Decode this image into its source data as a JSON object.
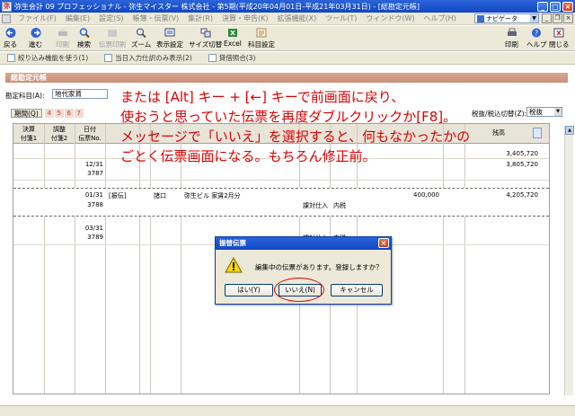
{
  "window": {
    "title": "弥生会計 09 プロフェッショナル - 弥生マイスター 株式会社 - 第5期(平成20年04月01日-平成21年03月31日) - [総勘定元帳]"
  },
  "menu": {
    "items": [
      "ファイル(F)",
      "編集(E)",
      "設定(S)",
      "帳簿・伝票(V)",
      "集計(R)",
      "決算・申告(K)",
      "拡張機能(X)",
      "ツール(T)",
      "ウィンドウ(W)",
      "ヘルプ(H)"
    ],
    "navi_label": "ナビゲータ"
  },
  "toolbar": {
    "back": "戻る",
    "forward": "進む",
    "print_disabled": "印刷",
    "search": "検索",
    "print_set": "伝票印刷",
    "zoom": "ズーム",
    "display_settings": "表示設定",
    "size_switch": "サイズ切替",
    "excel": "Excel",
    "account_settings": "科目設定",
    "print": "印刷",
    "help": "ヘルプ",
    "close": "閉じる"
  },
  "options": {
    "filter": "絞り込み機能を使う(1)",
    "today_only": "当日入力仕訳のみ表示(2)",
    "compound": "貸借照合(3)"
  },
  "ledger": {
    "tab_title": "総勘定元帳",
    "account_label": "勘定科目(A):",
    "account_value": "地代家賃",
    "period_label": "期間(Q)",
    "months": [
      "4",
      "5",
      "6",
      "7"
    ],
    "tax_label": "税抜/税込切替(Z):",
    "tax_value": "税抜",
    "headers": {
      "kessai": "決算",
      "tsukisen1": "付箋1",
      "chosei": "調整",
      "tsukisen2": "付箋2",
      "date": "日付",
      "voucher": "伝票No.",
      "balance": "残高"
    },
    "rows": [
      {
        "date": "",
        "voucher": "",
        "debit_account": "",
        "sub": "",
        "desc": "",
        "tax": "",
        "tax2": "",
        "amount": "",
        "balance": "3,405,720"
      },
      {
        "date": "12/31",
        "voucher": "3787",
        "debit_account": "",
        "sub": "",
        "desc": "",
        "tax": "",
        "tax2": "",
        "amount": "",
        "balance": "3,805,720"
      },
      {
        "date": "01/31",
        "voucher": "3788",
        "debit_account": "[振伝]",
        "sub": "諸口",
        "desc": "弥生ビル 家賃2月分",
        "tax": "課対仕入",
        "tax2": "内税",
        "amount": "400,000",
        "balance": "4,205,720"
      },
      {
        "date": "03/31",
        "voucher": "3789",
        "debit_account": "",
        "sub": "",
        "desc": "",
        "tax": "課対仕入",
        "tax2": "内税",
        "amount": "",
        "balance": ""
      }
    ]
  },
  "note": {
    "line1": "または [Alt] キー + [←] キーで前画面に戻り、",
    "line2": "使おうと思っていた伝票を再度ダブルクリックか[F8]。",
    "line3": "メッセージで「いいえ」を選択すると、何もなかったかの",
    "line4": "ごとく伝票画面になる。もちろん修正前。"
  },
  "dialog": {
    "title": "振替伝票",
    "message": "編集中の伝票があります。登録しますか？",
    "yes": "はい(Y)",
    "no": "いいえ(N)",
    "cancel": "キャンセル"
  },
  "colors": {
    "titlebar": "#1146c4",
    "note": "#e00000",
    "tab": "#c89078"
  }
}
